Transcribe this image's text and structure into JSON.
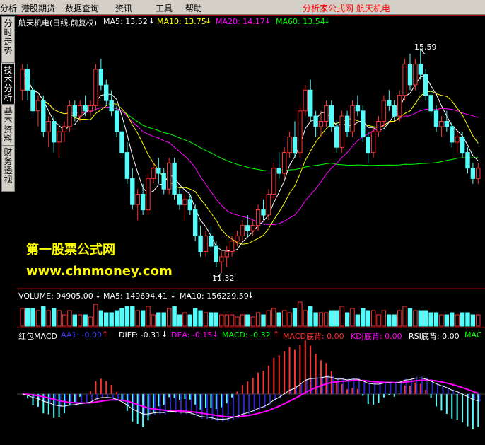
{
  "menu": {
    "items": [
      "分析",
      "港股期货",
      "数据查询",
      "资讯",
      "工具",
      "帮助"
    ],
    "right_links": [
      "分析家公式网",
      "航天机电"
    ]
  },
  "sidebar": {
    "tabs": [
      {
        "label": "分时走势",
        "active": false
      },
      {
        "label": "技术分析",
        "active": true
      },
      {
        "label": "基本资料",
        "active": false
      },
      {
        "label": "财务透视",
        "active": false
      }
    ]
  },
  "price_panel": {
    "title": "航天机电(日线,前复权)",
    "ma5": "MA5: 13.52",
    "ma10": "MA10: 13.75",
    "ma20": "MA20: 14.17",
    "ma60": "MA60: 13.54",
    "high_label": "15.59",
    "low_label": "11.32",
    "colors": {
      "ma5": "#ffffff",
      "ma10": "#ffff00",
      "ma20": "#ff00ff",
      "ma60": "#00ff00",
      "up": "#ff3232",
      "down": "#54fcfc"
    }
  },
  "watermark": {
    "line1": "第一股票公式网",
    "line2": "www.chnmoney.com"
  },
  "volume_panel": {
    "volume": "VOLUME: 94905.00",
    "ma5": "MA5: 149694.41",
    "ma10": "MA10: 156229.59"
  },
  "macd_panel": {
    "name": "红包MACD",
    "aa1": "AA1: -0.09",
    "diff": "DIFF: -0.31",
    "dea": "DEA: -0.15",
    "macd": "MACD: -0.32",
    "macd_div": "MACD底背: 0.00",
    "kdj_div": "KDJ底背: 0.00",
    "rsi_div": "RSI底背: 0.00",
    "mac": "MAC"
  },
  "chart_data": {
    "type": "candlestick",
    "price_range": [
      11.0,
      16.0
    ],
    "candles": [
      [
        14.8,
        15.3,
        14.6,
        15.2
      ],
      [
        15.2,
        15.3,
        14.6,
        14.8
      ],
      [
        14.8,
        15.0,
        14.3,
        14.4
      ],
      [
        14.4,
        14.7,
        14.1,
        14.6
      ],
      [
        14.6,
        14.7,
        13.9,
        14.0
      ],
      [
        14.0,
        14.3,
        13.7,
        14.2
      ],
      [
        14.2,
        14.3,
        13.6,
        13.8
      ],
      [
        13.8,
        14.1,
        13.5,
        14.0
      ],
      [
        14.0,
        14.2,
        13.8,
        14.1
      ],
      [
        14.1,
        14.6,
        14.0,
        14.5
      ],
      [
        14.5,
        14.6,
        14.2,
        14.3
      ],
      [
        14.3,
        14.6,
        14.2,
        14.5
      ],
      [
        14.5,
        14.7,
        14.3,
        14.4
      ],
      [
        14.4,
        14.6,
        14.3,
        14.5
      ],
      [
        14.5,
        15.3,
        14.4,
        15.2
      ],
      [
        15.2,
        15.4,
        14.8,
        14.9
      ],
      [
        14.9,
        15.0,
        14.5,
        14.6
      ],
      [
        14.6,
        14.8,
        14.3,
        14.4
      ],
      [
        14.4,
        14.5,
        13.9,
        14.0
      ],
      [
        14.0,
        14.2,
        13.5,
        13.6
      ],
      [
        13.6,
        13.8,
        13.0,
        13.1
      ],
      [
        13.1,
        13.3,
        12.5,
        12.6
      ],
      [
        12.6,
        12.9,
        12.3,
        12.8
      ],
      [
        12.8,
        13.0,
        12.4,
        12.5
      ],
      [
        12.5,
        13.2,
        12.4,
        13.1
      ],
      [
        13.1,
        13.4,
        13.0,
        13.3
      ],
      [
        13.3,
        13.5,
        13.0,
        13.2
      ],
      [
        13.2,
        13.3,
        12.8,
        12.9
      ],
      [
        12.9,
        13.5,
        12.8,
        13.4
      ],
      [
        13.4,
        13.5,
        12.7,
        12.8
      ],
      [
        12.8,
        12.9,
        12.5,
        12.6
      ],
      [
        12.6,
        12.8,
        12.3,
        12.7
      ],
      [
        12.7,
        12.8,
        12.4,
        12.5
      ],
      [
        12.5,
        12.6,
        11.9,
        12.0
      ],
      [
        12.0,
        12.2,
        11.6,
        11.7
      ],
      [
        11.7,
        12.1,
        11.6,
        12.0
      ],
      [
        12.0,
        12.2,
        11.7,
        11.8
      ],
      [
        11.8,
        11.9,
        11.4,
        11.5
      ],
      [
        11.5,
        11.7,
        11.3,
        11.6
      ],
      [
        11.6,
        11.8,
        11.4,
        11.7
      ],
      [
        11.7,
        12.0,
        11.6,
        11.9
      ],
      [
        11.9,
        12.1,
        11.8,
        12.0
      ],
      [
        12.0,
        12.3,
        11.9,
        12.2
      ],
      [
        12.2,
        12.4,
        12.0,
        12.1
      ],
      [
        12.1,
        12.3,
        12.0,
        12.2
      ],
      [
        12.2,
        12.6,
        12.1,
        12.5
      ],
      [
        12.5,
        12.7,
        12.3,
        12.4
      ],
      [
        12.4,
        12.9,
        12.3,
        12.8
      ],
      [
        12.8,
        13.4,
        12.7,
        13.3
      ],
      [
        13.3,
        13.6,
        13.1,
        13.2
      ],
      [
        13.2,
        13.7,
        13.1,
        13.6
      ],
      [
        13.6,
        14.0,
        13.5,
        13.9
      ],
      [
        13.9,
        14.2,
        13.5,
        13.6
      ],
      [
        13.6,
        14.5,
        13.5,
        14.4
      ],
      [
        14.4,
        14.9,
        14.3,
        14.8
      ],
      [
        14.8,
        15.0,
        14.2,
        14.3
      ],
      [
        14.3,
        14.4,
        13.9,
        14.1
      ],
      [
        14.1,
        14.4,
        13.9,
        14.2
      ],
      [
        14.2,
        14.6,
        14.1,
        14.5
      ],
      [
        14.5,
        14.6,
        14.0,
        14.1
      ],
      [
        14.1,
        14.2,
        13.6,
        13.7
      ],
      [
        13.7,
        14.4,
        13.6,
        14.3
      ],
      [
        14.3,
        14.4,
        13.9,
        14.0
      ],
      [
        14.0,
        14.6,
        13.9,
        14.5
      ],
      [
        14.5,
        14.7,
        14.3,
        14.4
      ],
      [
        14.4,
        14.5,
        13.8,
        13.9
      ],
      [
        13.9,
        14.0,
        13.4,
        13.6
      ],
      [
        13.6,
        14.1,
        13.5,
        14.0
      ],
      [
        14.0,
        14.3,
        13.9,
        14.2
      ],
      [
        14.2,
        14.7,
        14.1,
        14.6
      ],
      [
        14.6,
        14.8,
        14.4,
        14.5
      ],
      [
        14.5,
        14.6,
        14.2,
        14.3
      ],
      [
        14.3,
        14.8,
        14.2,
        14.7
      ],
      [
        14.7,
        15.4,
        14.6,
        15.3
      ],
      [
        15.3,
        15.5,
        14.8,
        14.9
      ],
      [
        14.9,
        15.4,
        14.8,
        15.3
      ],
      [
        15.3,
        15.6,
        15.0,
        15.1
      ],
      [
        15.1,
        15.2,
        14.6,
        14.7
      ],
      [
        14.7,
        14.8,
        14.3,
        14.4
      ],
      [
        14.4,
        14.5,
        14.0,
        14.1
      ],
      [
        14.1,
        14.3,
        13.9,
        14.2
      ],
      [
        14.2,
        14.4,
        14.0,
        14.1
      ],
      [
        14.1,
        14.2,
        13.7,
        13.8
      ],
      [
        13.8,
        14.0,
        13.6,
        13.9
      ],
      [
        13.9,
        14.0,
        13.5,
        13.6
      ],
      [
        13.6,
        13.7,
        13.2,
        13.3
      ],
      [
        13.3,
        13.4,
        13.0,
        13.1
      ],
      [
        13.1,
        13.4,
        13.0,
        13.3
      ]
    ]
  }
}
